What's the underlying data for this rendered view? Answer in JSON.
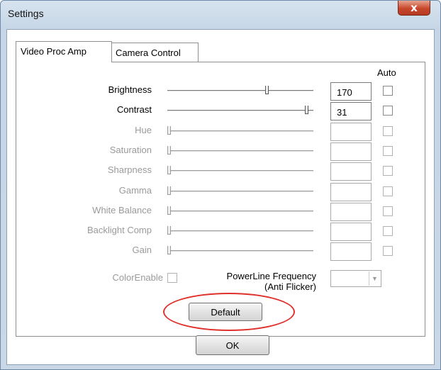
{
  "window": {
    "title": "Settings",
    "close_glyph": "x"
  },
  "tabs": [
    {
      "label": "Video Proc Amp",
      "active": true
    },
    {
      "label": "Camera Control",
      "active": false
    }
  ],
  "auto_header": "Auto",
  "controls": [
    {
      "label": "Brightness",
      "value": "170",
      "enabled": true,
      "slider_fraction": 0.69,
      "auto": false
    },
    {
      "label": "Contrast",
      "value": "31",
      "enabled": true,
      "slider_fraction": 0.97,
      "auto": false
    },
    {
      "label": "Hue",
      "value": "",
      "enabled": false,
      "slider_fraction": 0.0,
      "auto": false
    },
    {
      "label": "Saturation",
      "value": "",
      "enabled": false,
      "slider_fraction": 0.0,
      "auto": false
    },
    {
      "label": "Sharpness",
      "value": "",
      "enabled": false,
      "slider_fraction": 0.0,
      "auto": false
    },
    {
      "label": "Gamma",
      "value": "",
      "enabled": false,
      "slider_fraction": 0.0,
      "auto": false
    },
    {
      "label": "White Balance",
      "value": "",
      "enabled": false,
      "slider_fraction": 0.0,
      "auto": false
    },
    {
      "label": "Backlight Comp",
      "value": "",
      "enabled": false,
      "slider_fraction": 0.0,
      "auto": false
    },
    {
      "label": "Gain",
      "value": "",
      "enabled": false,
      "slider_fraction": 0.0,
      "auto": false
    }
  ],
  "color_enable": {
    "label": "ColorEnable",
    "checked": false
  },
  "powerline": {
    "label_line1": "PowerLine Frequency",
    "label_line2": "(Anti Flicker)",
    "value": ""
  },
  "buttons": {
    "default_label": "Default",
    "ok_label": "OK"
  },
  "colors": {
    "highlight_ring": "#e0302a",
    "close_button": "#c7472c"
  }
}
